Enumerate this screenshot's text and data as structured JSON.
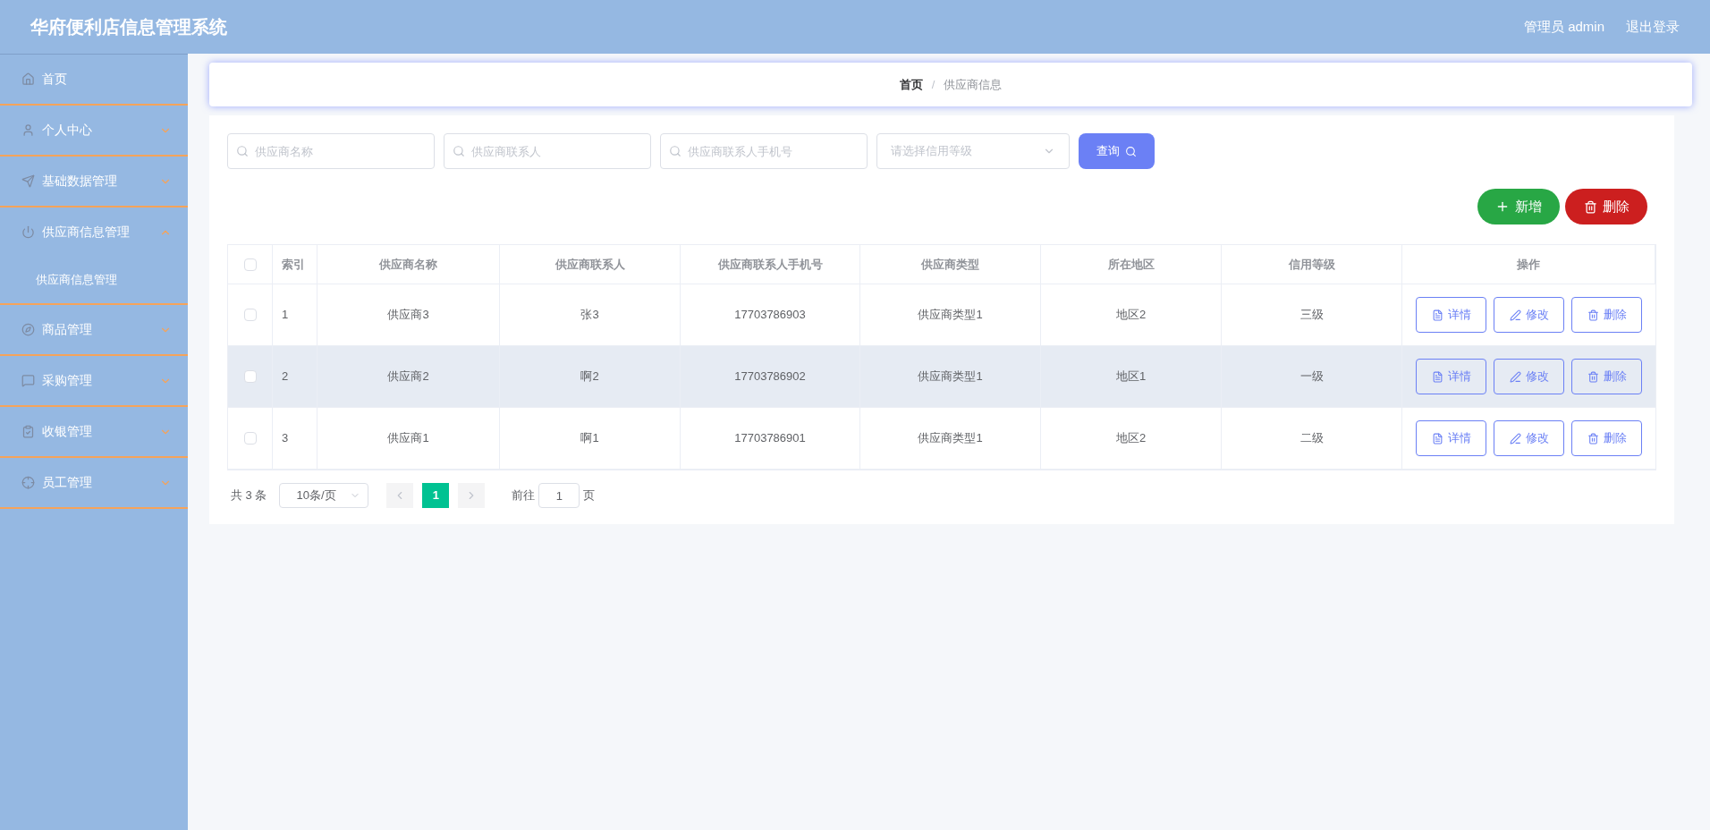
{
  "header": {
    "title": "华府便利店信息管理系统",
    "user": "管理员 admin",
    "logout": "退出登录"
  },
  "sidebar": {
    "items": [
      {
        "label": "首页"
      },
      {
        "label": "个人中心",
        "expanded": false
      },
      {
        "label": "基础数据管理",
        "expanded": false
      },
      {
        "label": "供应商信息管理",
        "expanded": true,
        "children": [
          {
            "label": "供应商信息管理"
          }
        ]
      },
      {
        "label": "商品管理",
        "expanded": false
      },
      {
        "label": "采购管理",
        "expanded": false
      },
      {
        "label": "收银管理",
        "expanded": false
      },
      {
        "label": "员工管理",
        "expanded": false
      }
    ]
  },
  "breadcrumb": [
    "首页",
    "供应商信息"
  ],
  "breadcrumb_separator": "/",
  "filters": [
    {
      "kind": "search",
      "placeholder": "供应商名称"
    },
    {
      "kind": "search",
      "placeholder": "供应商联系人"
    },
    {
      "kind": "search",
      "placeholder": "供应商联系人手机号"
    },
    {
      "kind": "select",
      "placeholder": "请选择信用等级"
    }
  ],
  "query_button": "查询",
  "add_button": "新增",
  "delete_button": "删除",
  "table": {
    "all_checked": false,
    "columns": [
      "索引",
      "供应商名称",
      "供应商联系人",
      "供应商联系人手机号",
      "供应商类型",
      "所在地区",
      "信用等级",
      "操作"
    ],
    "rows": [
      {
        "highlighted": false,
        "checked": false,
        "cells": [
          "1",
          "供应商3",
          "张3",
          "17703786903",
          "供应商类型1",
          "地区2",
          "三级"
        ],
        "actions": [
          "详情",
          "修改",
          "删除"
        ]
      },
      {
        "highlighted": true,
        "checked": false,
        "cells": [
          "2",
          "供应商2",
          "啊2",
          "17703786902",
          "供应商类型1",
          "地区1",
          "一级"
        ],
        "actions": [
          "详情",
          "修改",
          "删除"
        ]
      },
      {
        "highlighted": false,
        "checked": false,
        "cells": [
          "3",
          "供应商1",
          "啊1",
          "17703786901",
          "供应商类型1",
          "地区2",
          "二级"
        ],
        "actions": [
          "详情",
          "修改",
          "删除"
        ]
      }
    ]
  },
  "pagination": {
    "total": "共 3 条",
    "page_size": "10条/页",
    "pages": [
      {
        "label": "1",
        "selected": true
      }
    ],
    "goto_label": "前往",
    "goto_value": "1",
    "goto_suffix": "页"
  }
}
